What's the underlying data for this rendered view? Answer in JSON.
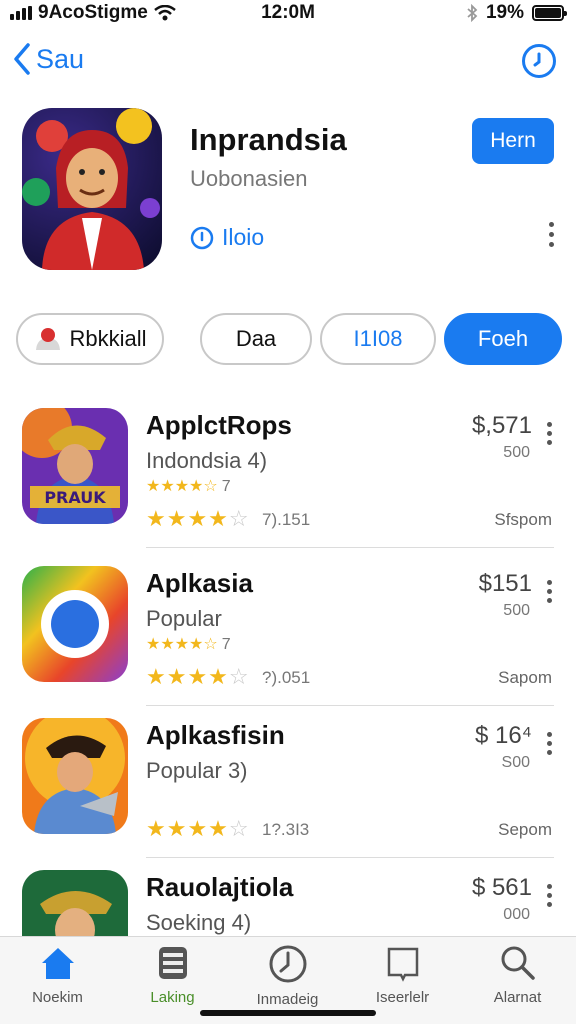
{
  "status_bar": {
    "carrier": "9AcoStigme",
    "time": "12:0M",
    "battery": "19%"
  },
  "nav": {
    "back_label": "Sau"
  },
  "hero": {
    "title": "Inprandsia",
    "subtitle": "Uobonasien",
    "link": "Iloio",
    "button": "Hern"
  },
  "chips": [
    "Rbkkiall",
    "Daa",
    "I1I08",
    "Foeh"
  ],
  "apps": [
    {
      "name": "ApplctRops",
      "sub": "Indondsia 4)",
      "small_stars": "★★★★☆",
      "small_rating": "7",
      "rating_count": "7).151",
      "price": "$,571",
      "price_sub": "500",
      "meta": "Sfspom"
    },
    {
      "name": "Aplkasia",
      "sub": "Popular",
      "small_stars": "★★★★☆",
      "small_rating": "7",
      "rating_count": "?).051",
      "price": "$151",
      "price_sub": "500",
      "meta": "Sapom"
    },
    {
      "name": "Aplkasfisin",
      "sub": "Popular  3)",
      "small_stars": "",
      "small_rating": "",
      "rating_count": "1?.3I3",
      "price": "$ 16⁴",
      "price_sub": "S00",
      "meta": "Sepom"
    },
    {
      "name": "Rauolajtiola",
      "sub": "Soeking  4)",
      "small_stars": "",
      "small_rating": "",
      "rating_count": "",
      "price": "$ 561",
      "price_sub": "000",
      "meta": ""
    }
  ],
  "tabs": [
    "Noekim",
    "Laking",
    "Inmadeig",
    "Iseerlelr",
    "Alarnat"
  ],
  "colors": {
    "accent": "#1a7bf0",
    "star": "#f2b71c",
    "active_tab": "#4a8f2a"
  }
}
